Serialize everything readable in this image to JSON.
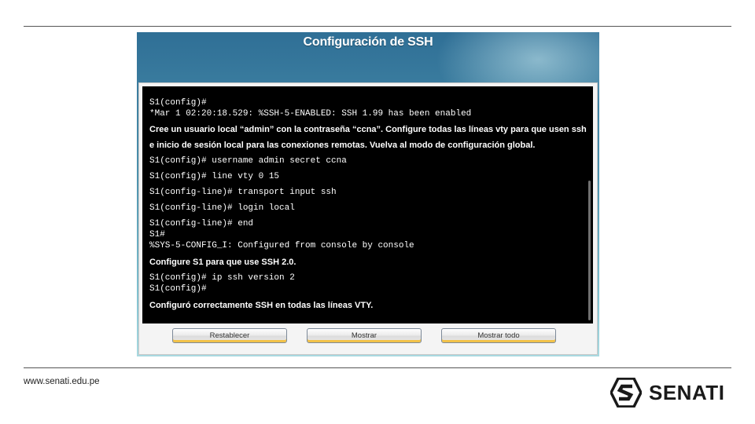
{
  "slide": {
    "footer_url": "www.senati.edu.pe",
    "logo_text": "SENATI"
  },
  "simulator": {
    "title": "Configuración de SSH",
    "terminal": {
      "lines": [
        {
          "kind": "mono",
          "text": "S1(config)#"
        },
        {
          "kind": "mono",
          "text": "*Mar 1 02:20:18.529: %SSH-5-ENABLED: SSH 1.99 has been enabled"
        },
        {
          "kind": "instr",
          "text": "Cree un usuario local “admin” con la contraseña “ccna”. Configure todas las líneas vty para que usen ssh"
        },
        {
          "kind": "instr",
          "text": "e inicio de sesión local para las conexiones remotas. Vuelva al modo de configuración global."
        },
        {
          "kind": "mono",
          "text": "S1(config)# username admin secret ccna"
        },
        {
          "kind": "mono",
          "text": "S1(config)# line vty 0 15"
        },
        {
          "kind": "mono",
          "text": "S1(config-line)# transport input ssh"
        },
        {
          "kind": "mono",
          "text": "S1(config-line)# login local"
        },
        {
          "kind": "mono",
          "text": "S1(config-line)# end"
        },
        {
          "kind": "mono",
          "text": "S1#"
        },
        {
          "kind": "mono",
          "text": "%SYS-5-CONFIG_I: Configured from console by console"
        },
        {
          "kind": "instr",
          "text": "Configure S1 para que use SSH 2.0."
        },
        {
          "kind": "mono",
          "text": "S1(config)# ip ssh version 2"
        },
        {
          "kind": "mono",
          "text": "S1(config)#"
        },
        {
          "kind": "instr",
          "text": "Configuró correctamente SSH en todas las líneas VTY."
        }
      ]
    },
    "buttons": {
      "reset": "Restablecer",
      "show": "Mostrar",
      "show_all": "Mostrar todo"
    }
  },
  "colors": {
    "terminal_bg": "#000000",
    "terminal_text": "#ffffff",
    "button_accent": "#f2c24a",
    "brand": "#1a1a1a"
  },
  "icons": {
    "logo": "senati-logo-icon"
  }
}
